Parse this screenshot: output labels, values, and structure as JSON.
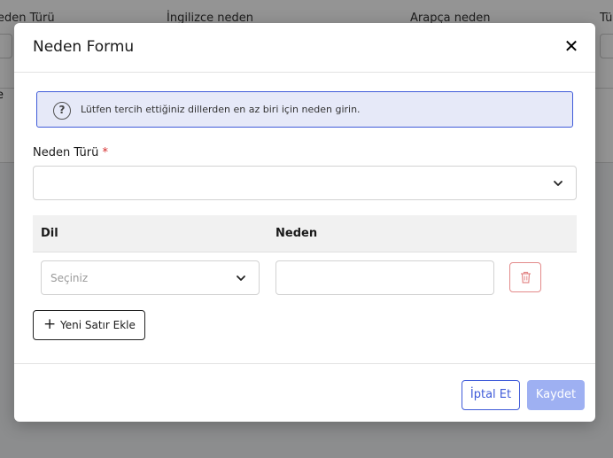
{
  "background": {
    "columns": [
      "eden Türü",
      "İngilizce neden",
      "Arapça neden",
      "Tür"
    ],
    "row_text": "e"
  },
  "modal": {
    "title": "Neden Formu",
    "close_icon": "close-icon",
    "info": {
      "icon": "question-icon",
      "text": "Lütfen tercih ettiğiniz dillerden en az biri için neden girin."
    },
    "reason_type": {
      "label": "Neden Türü",
      "required_mark": "*",
      "value": ""
    },
    "table": {
      "headers": [
        "Dil",
        "Neden"
      ],
      "rows": [
        {
          "language_placeholder": "Seçiniz",
          "reason_value": ""
        }
      ]
    },
    "add_row_label": "Yeni Satır Ekle",
    "cancel_label": "İptal Et",
    "save_label": "Kaydet"
  },
  "colors": {
    "accent": "#3f5bd9",
    "save_disabled": "#9eb0f2",
    "danger": "#e38a8a",
    "info_bg": "#e6e9f8"
  }
}
